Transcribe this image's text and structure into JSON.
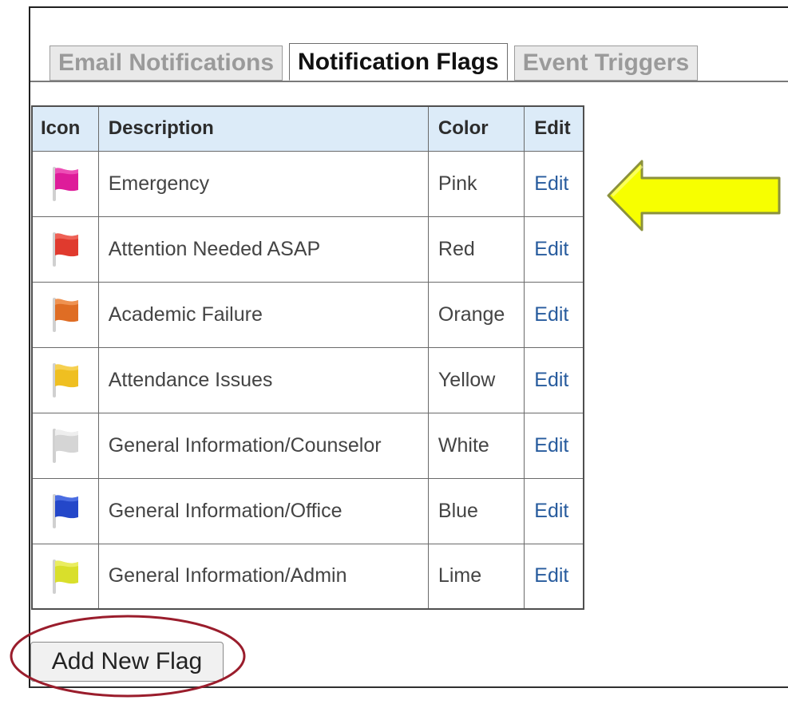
{
  "tabs": [
    {
      "label": "Email Notifications",
      "state": "inactive"
    },
    {
      "label": "Notification Flags",
      "state": "active"
    },
    {
      "label": "Event Triggers",
      "state": "inactive"
    }
  ],
  "table": {
    "headers": {
      "icon": "Icon",
      "description": "Description",
      "color": "Color",
      "edit": "Edit"
    },
    "rows": [
      {
        "icon": "pink-flag-icon",
        "description": "Emergency",
        "color": "Pink",
        "edit": "Edit"
      },
      {
        "icon": "red-flag-icon",
        "description": "Attention Needed ASAP",
        "color": "Red",
        "edit": "Edit"
      },
      {
        "icon": "orange-flag-icon",
        "description": "Academic Failure",
        "color": "Orange",
        "edit": "Edit"
      },
      {
        "icon": "yellow-flag-icon",
        "description": "Attendance Issues",
        "color": "Yellow",
        "edit": "Edit"
      },
      {
        "icon": "white-flag-icon",
        "description": "General Information/Counselor",
        "color": "White",
        "edit": "Edit"
      },
      {
        "icon": "blue-flag-icon",
        "description": "General Information/Office",
        "color": "Blue",
        "edit": "Edit"
      },
      {
        "icon": "lime-flag-icon",
        "description": "General Information/Admin",
        "color": "Lime",
        "edit": "Edit"
      }
    ]
  },
  "actions": {
    "add_flag_label": "Add New Flag"
  },
  "annotations": {
    "arrow_icon": "left-arrow-icon",
    "circle_icon": "highlight-oval-icon",
    "arrow_color": "#f7ff00",
    "arrow_stroke": "#8b913d",
    "circle_color": "#9a1d2c"
  },
  "colors": {
    "header_background": "#dcebf8",
    "link_blue": "#275b9d",
    "pink_flag": "#de1c9a",
    "red_flag": "#e03a2e",
    "orange_flag": "#df6d24",
    "yellow_flag": "#efbf21",
    "white_flag": "#d5d5d5",
    "blue_flag": "#2447c9",
    "lime_flag": "#d9df2b"
  }
}
